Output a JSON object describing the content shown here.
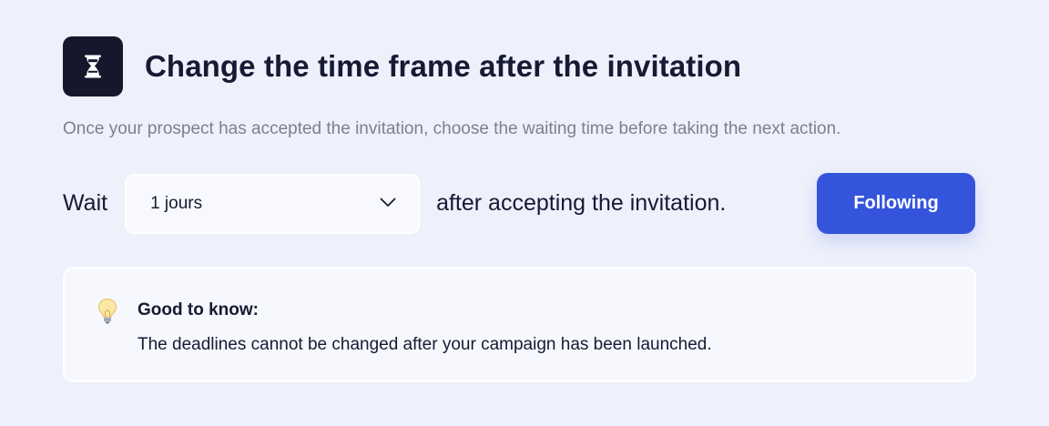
{
  "header": {
    "icon": "hourglass-icon",
    "title": "Change the time frame after the invitation"
  },
  "description": "Once your prospect has accepted the invitation, choose the waiting time before taking the next action.",
  "wait_row": {
    "label": "Wait",
    "select": {
      "value": "1 jours",
      "icon": "chevron-down-icon"
    },
    "suffix": "after accepting the invitation."
  },
  "next_button": {
    "label": "Following",
    "color": "#3455db"
  },
  "info_card": {
    "icon": "lightbulb-icon",
    "title": "Good to know:",
    "text": "The deadlines cannot be changed after your campaign has been launched."
  },
  "colors": {
    "background": "#eef0fb",
    "text": "#161a33",
    "muted": "#7c8093",
    "accent": "#3455db"
  }
}
